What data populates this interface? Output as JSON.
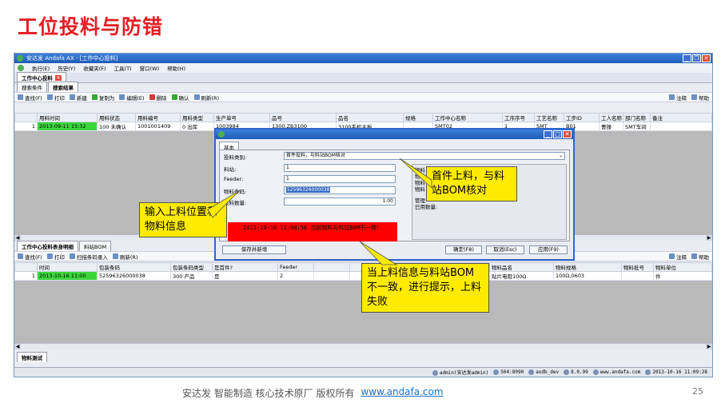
{
  "slide": {
    "title": "工位投料与防错",
    "footer_text": "安达发  智能制造 核心技术原厂   版权所有",
    "footer_link": "www.andafa.com",
    "page_number": "25"
  },
  "window": {
    "title": "安达发 Andafa AX - [工作中心投料]"
  },
  "menu": [
    "执行(E)",
    "历史(Y)",
    "收藏夹(F)",
    "工具(T)",
    "窗口(W)",
    "帮助(H)"
  ],
  "tab": {
    "label": "工作中心投料"
  },
  "subtabs": [
    "搜索条件",
    "搜索结果"
  ],
  "toolbar": {
    "items": [
      "查找(F)",
      "打印",
      "新建",
      "复制为",
      "编辑(E)",
      "删除",
      "确认",
      "刷新(R)"
    ],
    "right": [
      "注释",
      "帮助"
    ]
  },
  "top_grid": {
    "headers": [
      "",
      "用料时间",
      "用料状态",
      "用料编号",
      "用料类型",
      "生产单号",
      "品号",
      "品名",
      "规格",
      "工作中心名称",
      "工序序号",
      "工艺名称",
      "工步ID",
      "工人名称",
      "部门名称",
      "备注"
    ],
    "rows": [
      [
        "1",
        "2013-09-11 15:32",
        "100 未确认",
        "1001001409",
        "0 出库",
        "1003984",
        "1300.ZB3100",
        "3100手机主板",
        "",
        "SMT02",
        "1",
        "SMT",
        "B01",
        "曹操",
        "SMT车间",
        ""
      ]
    ]
  },
  "bottom_tabs": [
    "工作中心投料表身明细",
    "料站BOM"
  ],
  "bottom_toolbar": {
    "items": [
      "查找(F)",
      "打印",
      "扫描条码录入",
      "刷新(R)"
    ],
    "right": [
      "注释",
      "帮助"
    ]
  },
  "bottom_grid": {
    "headers": [
      "",
      "时间",
      "包装条码",
      "包装条码类型",
      "是首件?",
      "Feeder",
      "",
      "",
      "",
      "",
      "物料品名",
      "物料规格",
      "物料批号",
      "物料单位"
    ],
    "rows": [
      [
        "1",
        "2013-10-16 11:00",
        "52596326000038",
        "300 产品",
        "是",
        "2",
        "",
        "",
        "",
        "",
        "贴片电阻100Ω",
        "100Ω,0603",
        "",
        "件"
      ]
    ]
  },
  "bottom_footer_tab": "物料测试",
  "status": {
    "user": "admin(安达发admin)",
    "server": "S04:8090",
    "db": "axdb_dev",
    "version": "8.0.99",
    "site": "www.andafa.com",
    "datetime": "2013-10-16 11:09:28"
  },
  "dialog": {
    "tab": "基本",
    "fields": [
      {
        "label": "投料类别:",
        "value": "首件投料，与料站BOM核对"
      },
      {
        "label": "料站:",
        "value": "1"
      },
      {
        "label": "Feeder:",
        "value": "1"
      },
      {
        "label": "物料条码:",
        "value": "52596326000038"
      },
      {
        "label": "投料数量:",
        "value": "1.00"
      }
    ],
    "error": "2013-10-16 11:08:56 当前物料与料站BOM不一致！",
    "info_lines": [
      "物料",
      "物料",
      "物料",
      "物料",
      "",
      "管理",
      "已用数量:"
    ],
    "buttons": [
      "保存并新增",
      "确定(F8)",
      "取消(Esc)",
      "应用(F9)"
    ]
  },
  "callouts": {
    "input": "输入上料位置和物料信息",
    "first": "首件上料，与料站BOM核对",
    "mismatch": "当上料信息与料站BOM不一致，进行提示，上料失败"
  }
}
